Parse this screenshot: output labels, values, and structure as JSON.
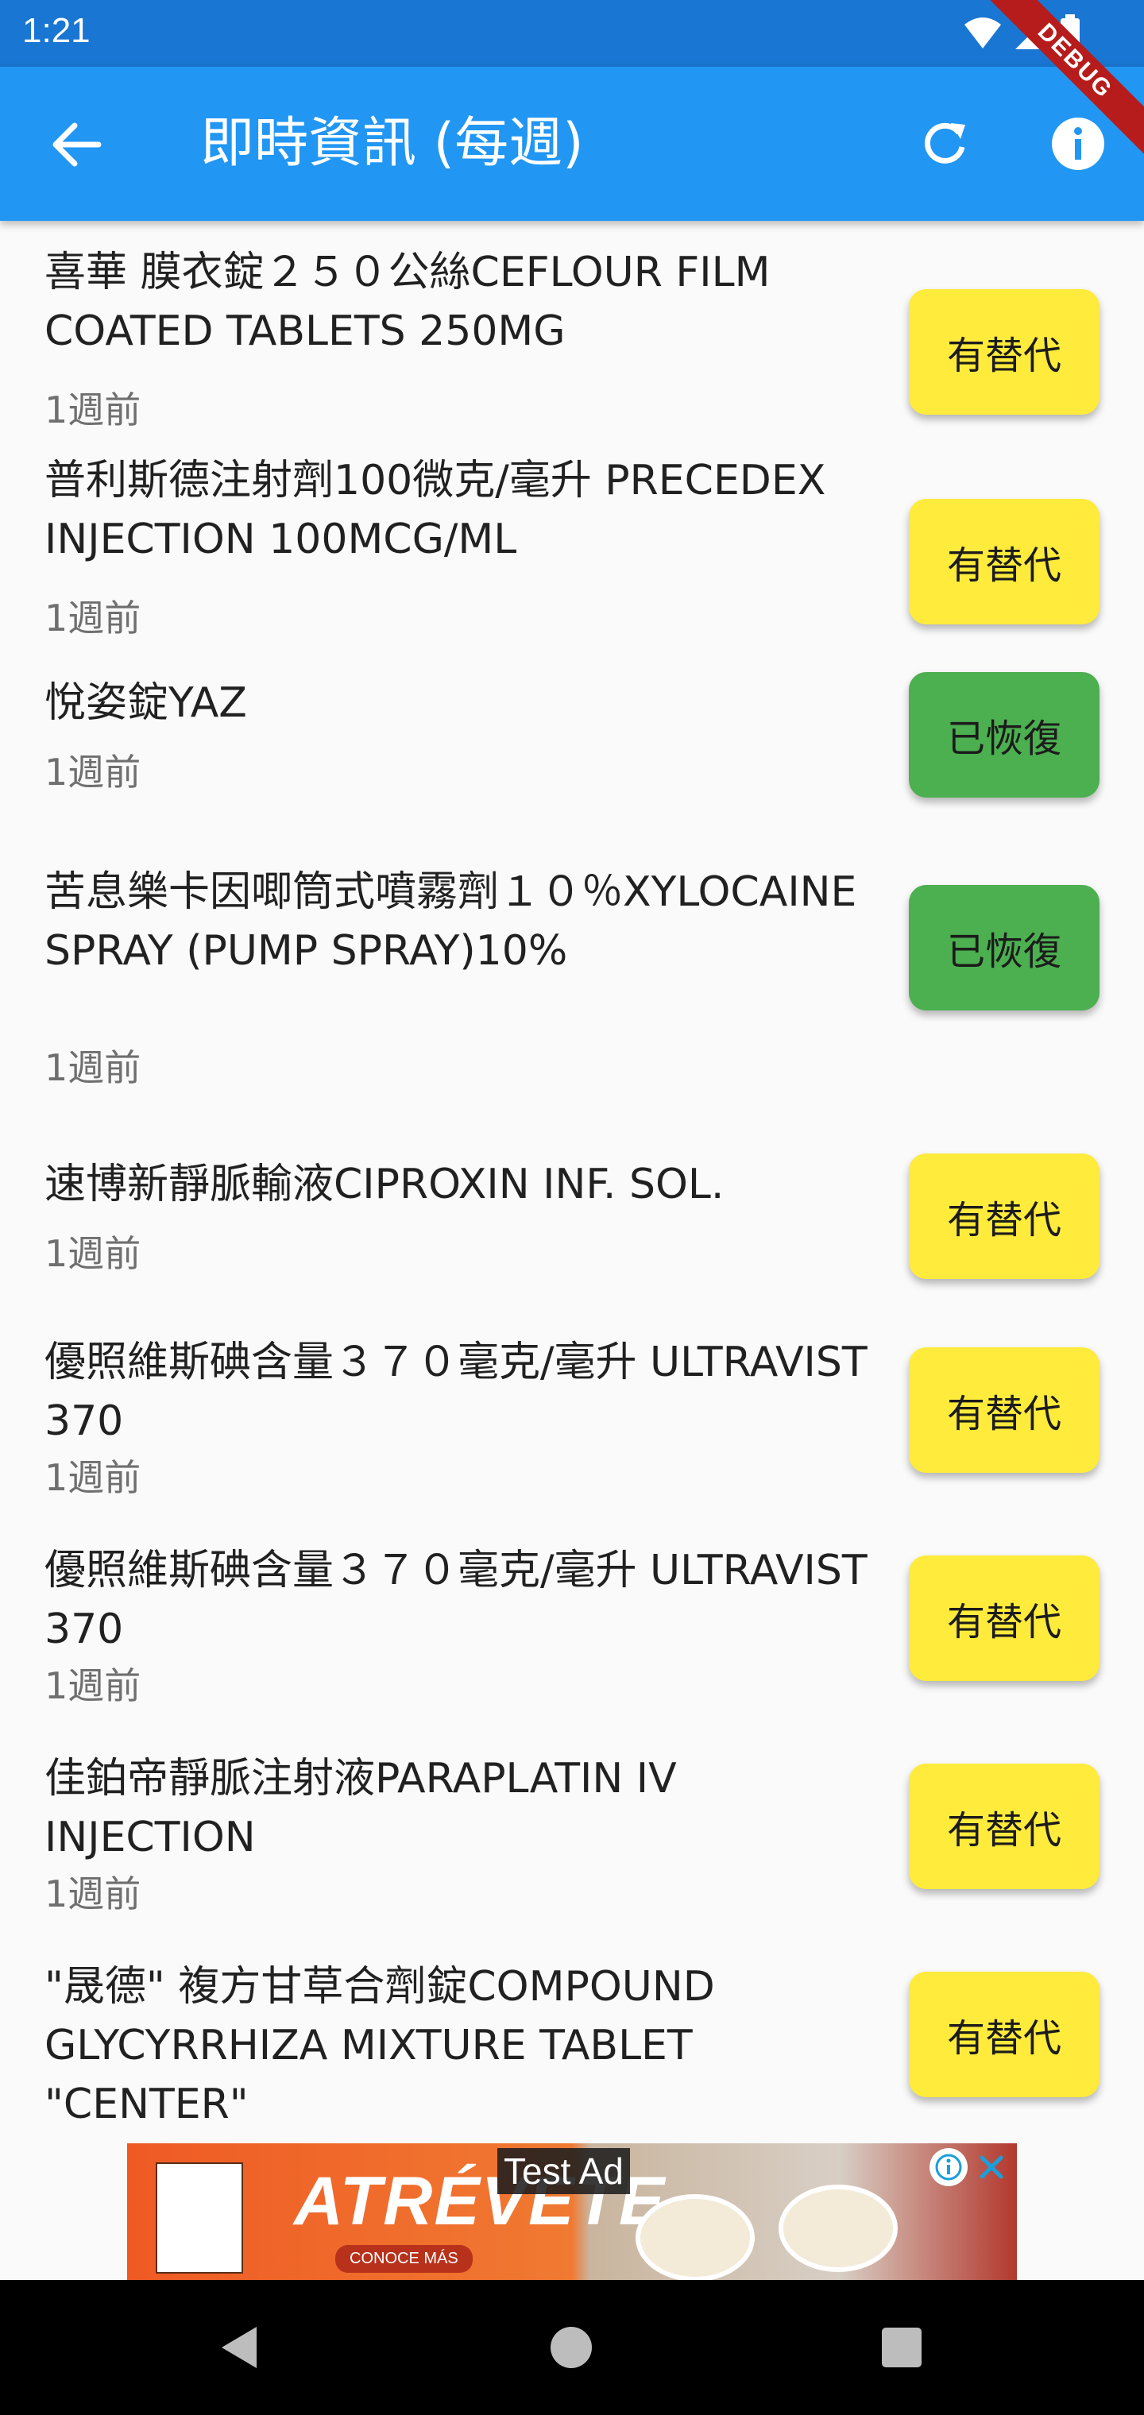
{
  "status_bar": {
    "time": "1:21"
  },
  "app_bar": {
    "title": "即時資訊 (每週)"
  },
  "debug_banner": "DEBUG",
  "items": [
    {
      "name": "喜華 膜衣錠２５０公絲CEFLOUR FILM COATED TABLETS 250MG",
      "time": "1週前",
      "status": "有替代",
      "status_type": "alternative"
    },
    {
      "name": "普利斯德注射劑100微克/毫升 PRECEDEX INJECTION 100MCG/ML",
      "time": "1週前",
      "status": "有替代",
      "status_type": "alternative"
    },
    {
      "name": "悅姿錠YAZ",
      "time": "1週前",
      "status": "已恢復",
      "status_type": "recovered"
    },
    {
      "name": "苦息樂卡因唧筒式噴霧劑１０％XYLOCAINE SPRAY (PUMP SPRAY)10%",
      "time": "1週前",
      "status": "已恢復",
      "status_type": "recovered"
    },
    {
      "name": "速博新靜脈輸液CIPROXIN INF. SOL.",
      "time": "1週前",
      "status": "有替代",
      "status_type": "alternative"
    },
    {
      "name": "優照維斯碘含量３７０毫克/毫升 ULTRAVIST 370",
      "time": "1週前",
      "status": "有替代",
      "status_type": "alternative"
    },
    {
      "name": "優照維斯碘含量３７０毫克/毫升 ULTRAVIST 370",
      "time": "1週前",
      "status": "有替代",
      "status_type": "alternative"
    },
    {
      "name": "佳鉑帝靜脈注射液PARAPLATIN IV INJECTION",
      "time": "1週前",
      "status": "有替代",
      "status_type": "alternative"
    },
    {
      "name": "\"晟德\" 複方甘草合劑錠COMPOUND GLYCYRRHIZA MIXTURE TABLET \"CENTER\"",
      "time": "",
      "status": "有替代",
      "status_type": "alternative"
    }
  ],
  "ad": {
    "label": "Test Ad",
    "headline": "ATRÉVETE",
    "cta": "CONOCE MÁS"
  },
  "colors": {
    "app_bar": "#2196f3",
    "status_bar": "#1976d2",
    "alternative": "#ffeb3b",
    "recovered": "#4caf50"
  }
}
